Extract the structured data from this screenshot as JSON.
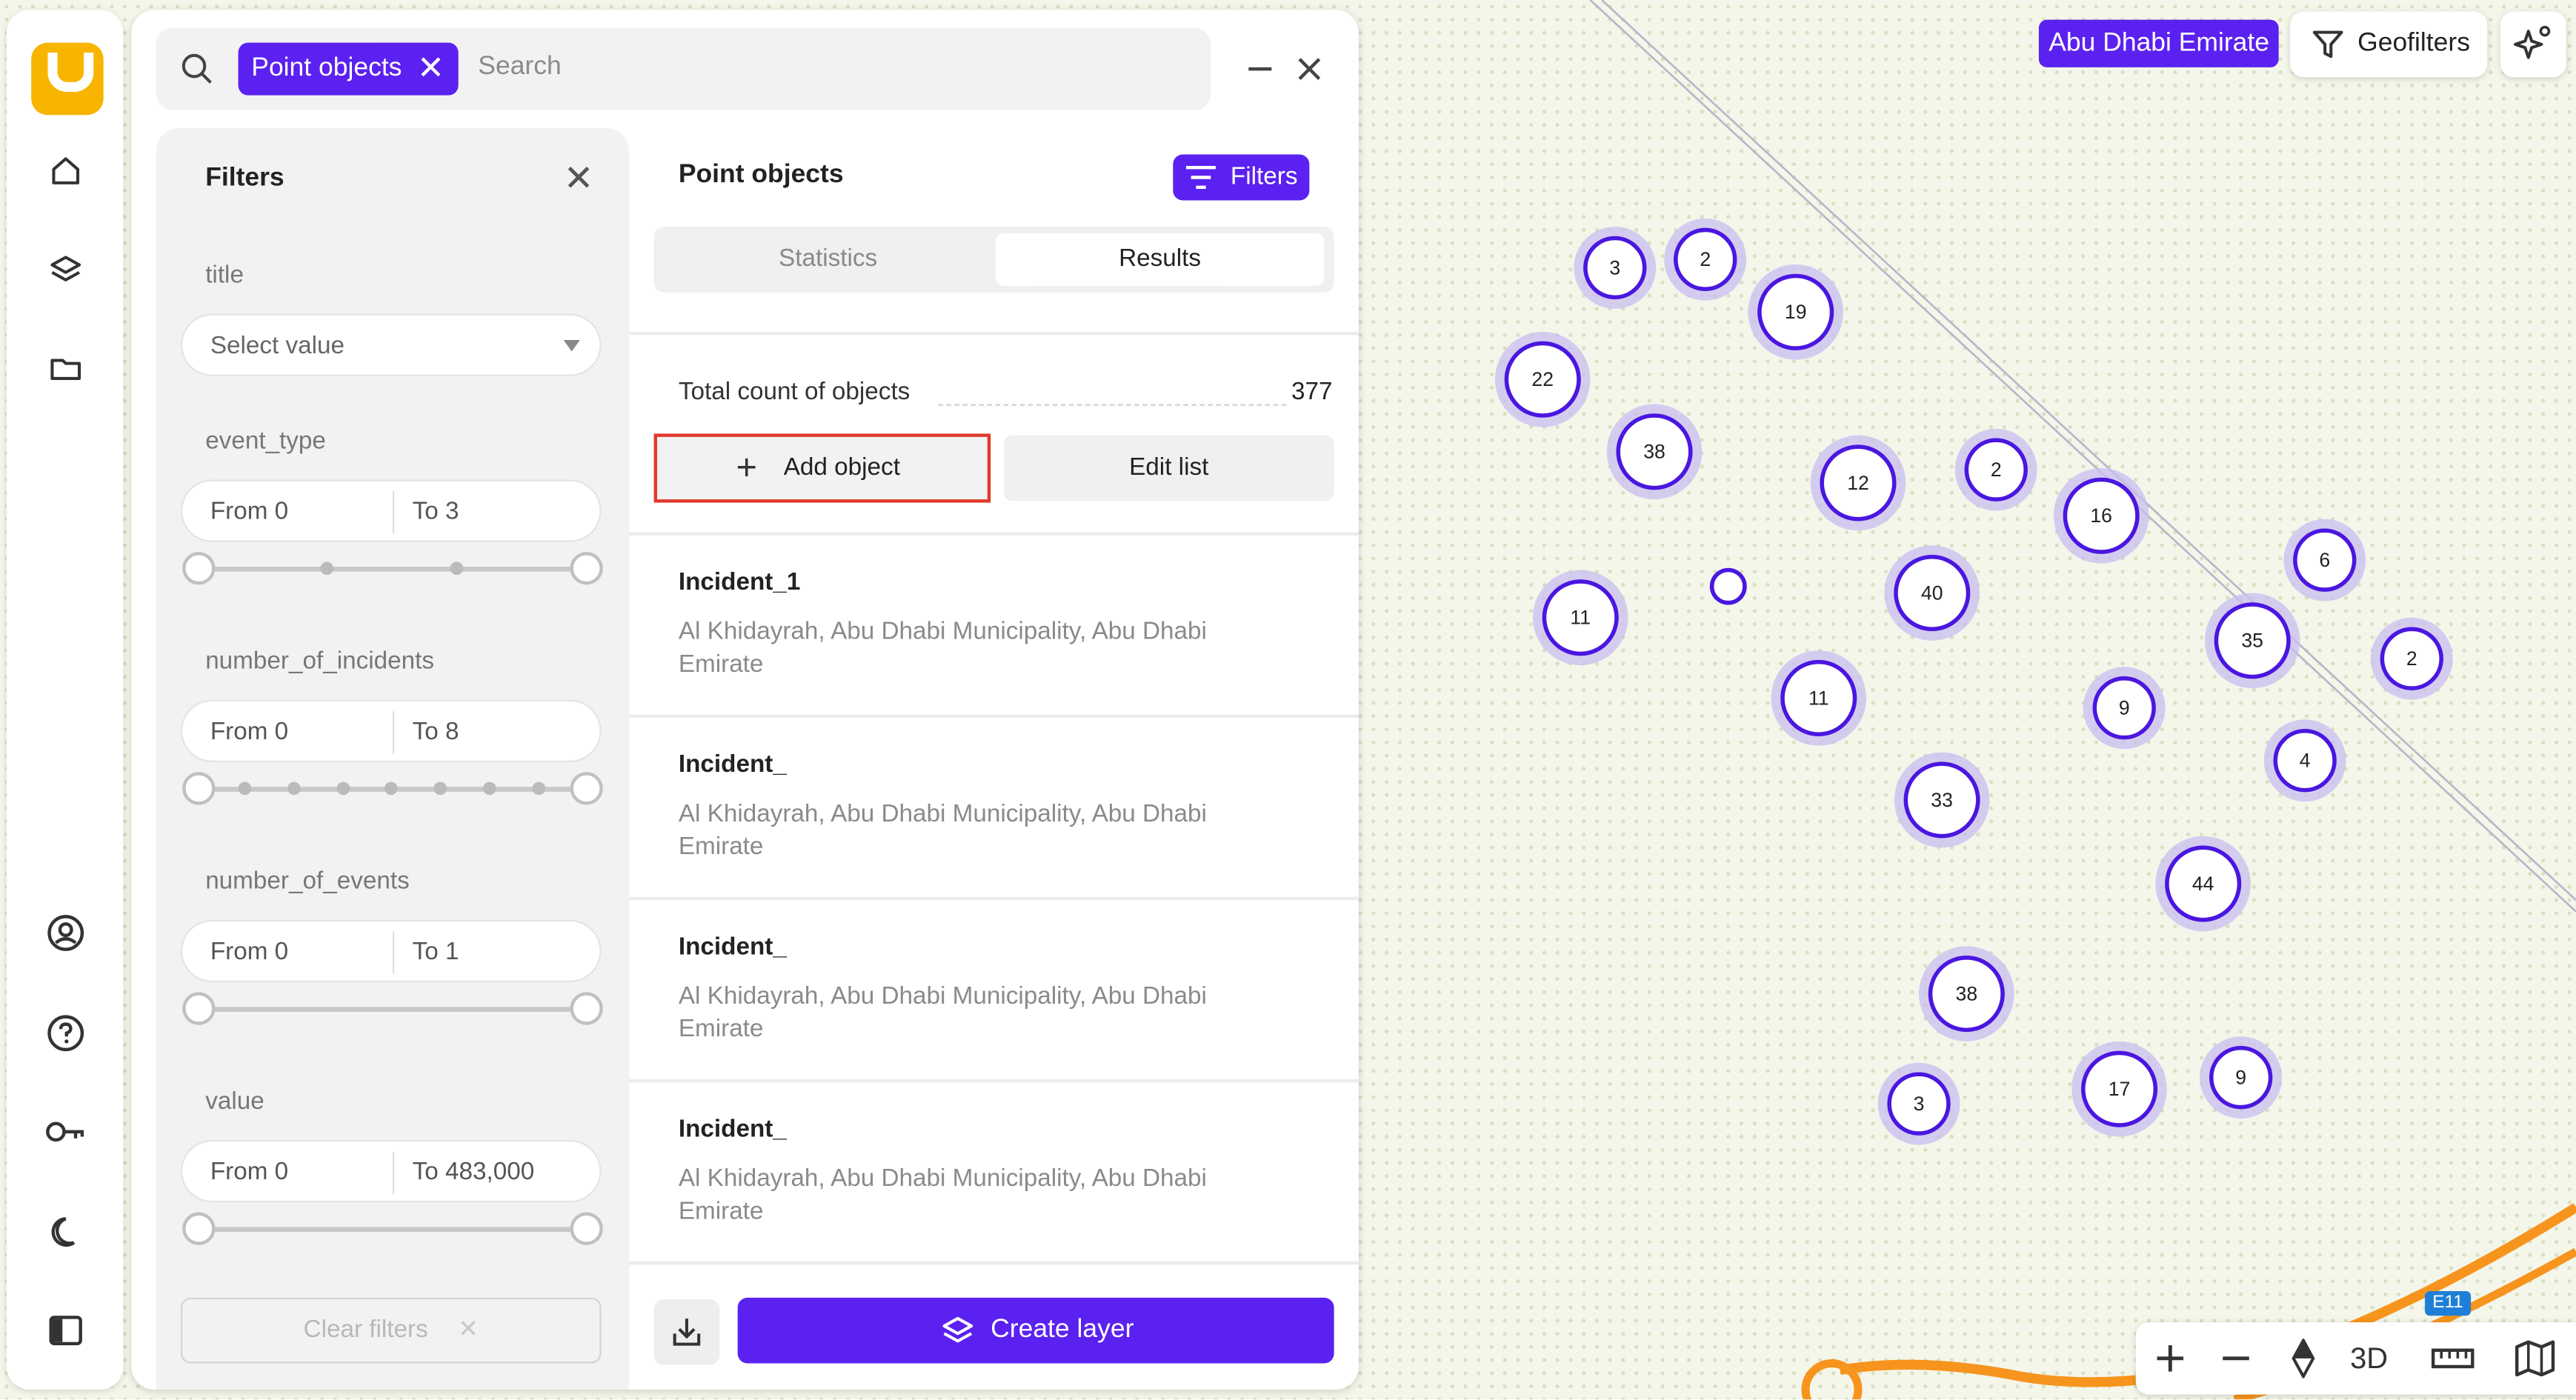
{
  "search": {
    "chip_label": "Point objects",
    "placeholder": "Search"
  },
  "filters": {
    "title": "Filters",
    "fields": [
      {
        "label": "title",
        "type": "select",
        "placeholder": "Select value"
      },
      {
        "label": "event_type",
        "type": "range",
        "from": "From 0",
        "to": "To 3"
      },
      {
        "label": "number_of_incidents",
        "type": "range",
        "from": "From 0",
        "to": "To 8"
      },
      {
        "label": "number_of_events",
        "type": "range",
        "from": "From 0",
        "to": "To 1"
      },
      {
        "label": "value",
        "type": "range",
        "from": "From 0",
        "to": "To 483,000"
      }
    ],
    "clear_label": "Clear filters"
  },
  "results": {
    "title": "Point objects",
    "filters_button": "Filters",
    "tabs": [
      "Statistics",
      "Results"
    ],
    "active_tab": "Results",
    "total_label": "Total count of objects",
    "total_value": "377",
    "add_label": "Add object",
    "edit_label": "Edit list",
    "items": [
      {
        "name": "Incident_1",
        "address": "Al Khidayrah, Abu Dhabi Municipality, Abu Dhabi Emirate"
      },
      {
        "name": "Incident_",
        "address": "Al Khidayrah, Abu Dhabi Municipality, Abu Dhabi Emirate"
      },
      {
        "name": "Incident_",
        "address": "Al Khidayrah, Abu Dhabi Municipality, Abu Dhabi Emirate"
      },
      {
        "name": "Incident_",
        "address": "Al Khidayrah, Abu Dhabi Municipality, Abu Dhabi Emirate"
      }
    ],
    "create_layer_label": "Create layer"
  },
  "map": {
    "region_label": "Abu Dhabi Emirate",
    "geofilters_label": "Geofilters",
    "view_3d_label": "3D",
    "road_label": "E11",
    "clusters": [
      "3",
      "2",
      "19",
      "22",
      "38",
      "12",
      "2",
      "16",
      "6",
      "11",
      "",
      "40",
      "35",
      "2",
      "11",
      "9",
      "4",
      "33",
      "44",
      "38",
      "3",
      "17",
      "9"
    ]
  },
  "colors": {
    "accent": "#5b21f0",
    "logo": "#f7b500",
    "highlight": "#e03a2c",
    "road": "#f7941d"
  },
  "icons": {
    "rail": [
      "home-icon",
      "layers-icon",
      "folder-icon",
      "user-icon",
      "help-icon",
      "key-icon",
      "moon-icon",
      "panel-icon"
    ]
  }
}
